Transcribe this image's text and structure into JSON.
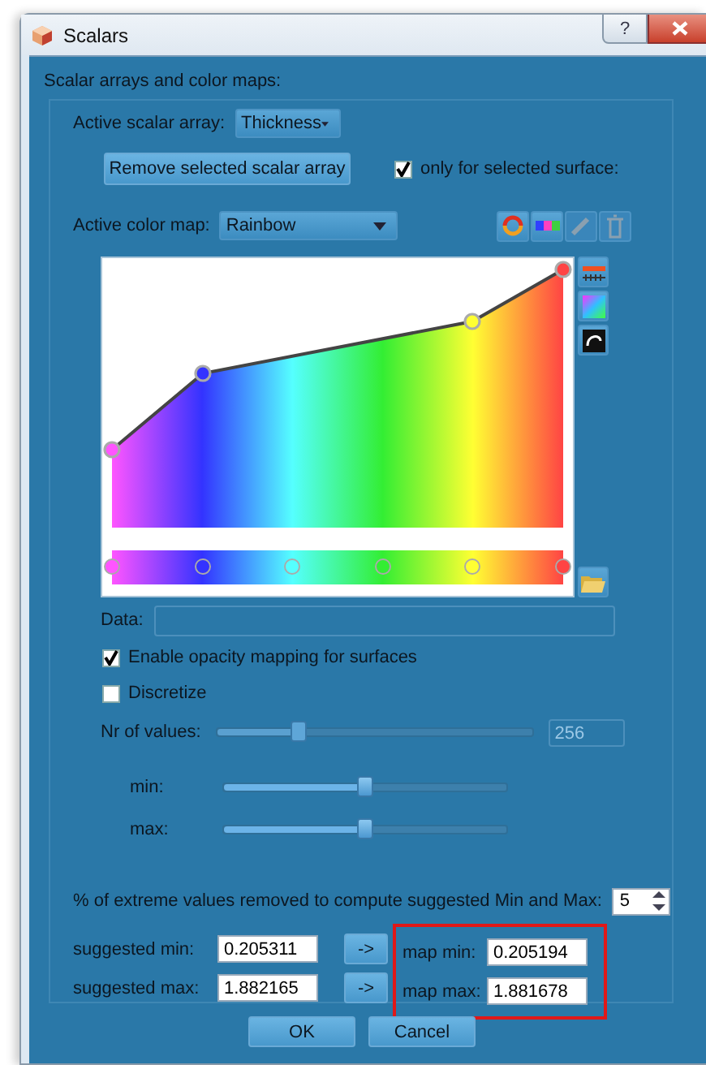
{
  "window": {
    "title": "Scalars",
    "help_label": "?"
  },
  "group": {
    "title": "Scalar arrays and color maps:"
  },
  "active_scalar_array": {
    "label": "Active scalar array:",
    "value": "Thickness"
  },
  "remove_button": "Remove selected scalar array",
  "only_selected": {
    "label": "only for selected surface:",
    "checked": true
  },
  "active_color_map": {
    "label": "Active color map:",
    "value": "Rainbow"
  },
  "color_stops": [
    {
      "color": "#ff55ff"
    },
    {
      "color": "#3333ff"
    },
    {
      "color": "#55ffff"
    },
    {
      "color": "#33ee33"
    },
    {
      "color": "#ffff33"
    },
    {
      "color": "#ff4444"
    }
  ],
  "opacity_points": [
    {
      "color": "#ff55ff"
    },
    {
      "color": "#3333ff"
    },
    {
      "color": "#ffff33"
    },
    {
      "color": "#ff4444"
    }
  ],
  "data_field": {
    "label": "Data:"
  },
  "enable_opacity": {
    "label": "Enable opacity mapping for surfaces",
    "checked": true
  },
  "discretize": {
    "label": "Discretize",
    "checked": false
  },
  "nr_of_values": {
    "label": "Nr of values:",
    "level": 0.26,
    "value": "256",
    "disabled": true
  },
  "min_slider": {
    "label": "min:",
    "level": 0.5
  },
  "max_slider": {
    "label": "max:",
    "level": 0.5
  },
  "extreme": {
    "label": "% of extreme values removed to compute suggested Min and Max:",
    "value": "5"
  },
  "rows": [
    {
      "suggested_label": "suggested min:",
      "suggested_value": "0.205311",
      "arrow": "->",
      "map_label": "map min:",
      "map_value": "0.205194"
    },
    {
      "suggested_label": "suggested max:",
      "suggested_value": "1.882165",
      "arrow": "->",
      "map_label": "map max:",
      "map_value": "1.881678"
    }
  ],
  "map_range_highlighted": true,
  "buttons": [
    "OK",
    "Cancel"
  ]
}
